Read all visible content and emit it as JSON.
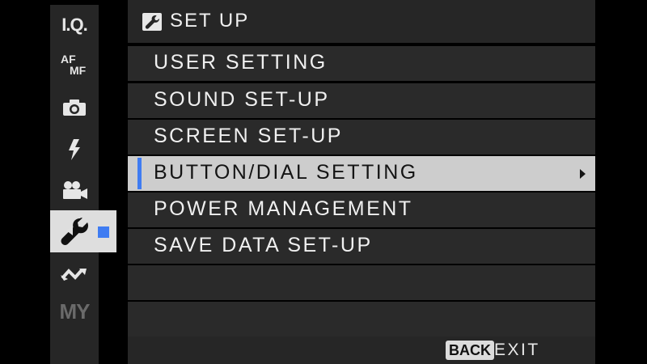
{
  "sidebar": {
    "tabs": [
      {
        "id": "iq",
        "text": "I.Q.",
        "icon": "image-quality-text"
      },
      {
        "id": "afmf",
        "text_top": "AF",
        "text_bottom": "MF",
        "icon": "af-mf-text"
      },
      {
        "id": "shooting",
        "icon": "camera-icon"
      },
      {
        "id": "flash",
        "icon": "flash-icon"
      },
      {
        "id": "movie",
        "icon": "movie-camera-icon"
      },
      {
        "id": "setup",
        "icon": "wrench-icon",
        "active": true
      },
      {
        "id": "connection",
        "icon": "connection-icon"
      },
      {
        "id": "my",
        "text": "MY",
        "icon": "my-menu-text"
      }
    ]
  },
  "header": {
    "icon": "wrench-icon",
    "title": "SET UP"
  },
  "menu": {
    "items": [
      {
        "label": "USER SETTING"
      },
      {
        "label": "SOUND SET-UP"
      },
      {
        "label": "SCREEN SET-UP"
      },
      {
        "label": "BUTTON/DIAL SETTING",
        "selected": true,
        "has_submenu": true
      },
      {
        "label": "POWER MANAGEMENT"
      },
      {
        "label": "SAVE DATA SET-UP"
      },
      {
        "label": ""
      },
      {
        "label": ""
      }
    ]
  },
  "footer": {
    "back_key": "BACK",
    "exit_label": "EXIT"
  },
  "colors": {
    "accent": "#3f7cf2",
    "row_bg": "#2a2a2a",
    "selected_bg": "#cdcdcd"
  }
}
